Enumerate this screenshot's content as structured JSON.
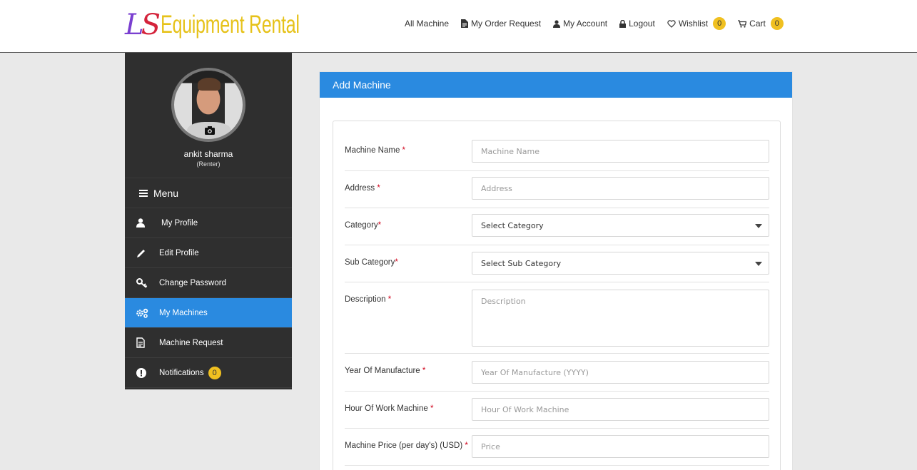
{
  "logo": {
    "mark_l": "L",
    "mark_s": "S",
    "text": "Equipment Rental"
  },
  "nav": {
    "all_machine": "All Machine",
    "my_order_request": "My Order Request",
    "my_account": "My Account",
    "logout": "Logout",
    "wishlist": "Wishlist",
    "wishlist_count": "0",
    "cart": "Cart",
    "cart_count": "0"
  },
  "sidebar": {
    "user_name": "ankit sharma",
    "user_role": "(Renter)",
    "menu_label": "Menu",
    "items": [
      {
        "label": "My Profile",
        "icon": "user-icon"
      },
      {
        "label": "Edit Profile",
        "icon": "pencil-icon"
      },
      {
        "label": "Change Password",
        "icon": "key-icon"
      },
      {
        "label": "My Machines",
        "icon": "gears-icon",
        "active": true
      },
      {
        "label": "Machine Request",
        "icon": "document-icon"
      },
      {
        "label": "Notifications",
        "icon": "exclamation-icon",
        "badge": "0"
      }
    ]
  },
  "form": {
    "title": "Add Machine",
    "fields": {
      "machine_name": {
        "label": "Machine Name",
        "placeholder": "Machine Name"
      },
      "address": {
        "label": "Address",
        "placeholder": "Address"
      },
      "category": {
        "label": "Category",
        "selected": "Select Category"
      },
      "sub_category": {
        "label": "Sub Category",
        "selected": "Select Sub Category"
      },
      "description": {
        "label": "Description",
        "placeholder": "Description"
      },
      "year": {
        "label": "Year Of Manufacture",
        "placeholder": "Year Of Manufacture (YYYY)"
      },
      "hours": {
        "label": "Hour Of Work Machine",
        "placeholder": "Hour Of Work Machine"
      },
      "price": {
        "label": "Machine Price (per day's) (USD)",
        "placeholder": "Price"
      }
    },
    "required_marker": "*"
  },
  "colors": {
    "accent": "#2a8ae0",
    "sidebar": "#2f2f2f",
    "badge": "#f0c020",
    "required": "#d0021b"
  }
}
